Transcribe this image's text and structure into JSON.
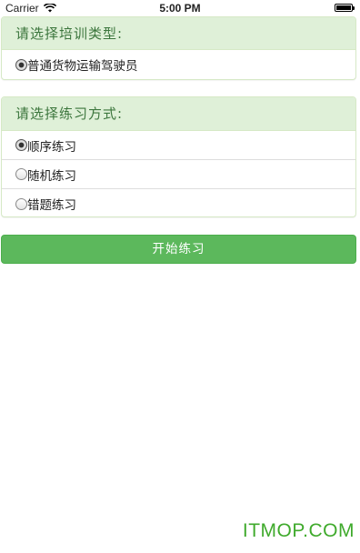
{
  "status_bar": {
    "carrier": "Carrier",
    "time": "5:00 PM"
  },
  "training_type": {
    "heading": "请选择培训类型:",
    "options": [
      {
        "label": "普通货物运输驾驶员",
        "checked": true
      }
    ]
  },
  "practice_mode": {
    "heading": "请选择练习方式:",
    "options": [
      {
        "label": "顺序练习",
        "checked": true
      },
      {
        "label": "随机练习",
        "checked": false
      },
      {
        "label": "错题练习",
        "checked": false
      }
    ]
  },
  "start_button": {
    "label": "开始练习"
  },
  "watermark": {
    "text": "ITMOP.COM"
  },
  "colors": {
    "panel_heading_bg": "#dff0d8",
    "panel_heading_text": "#3c763d",
    "panel_border": "#d6e9c6",
    "button_bg": "#5cb85c",
    "watermark": "#3faa2c"
  }
}
